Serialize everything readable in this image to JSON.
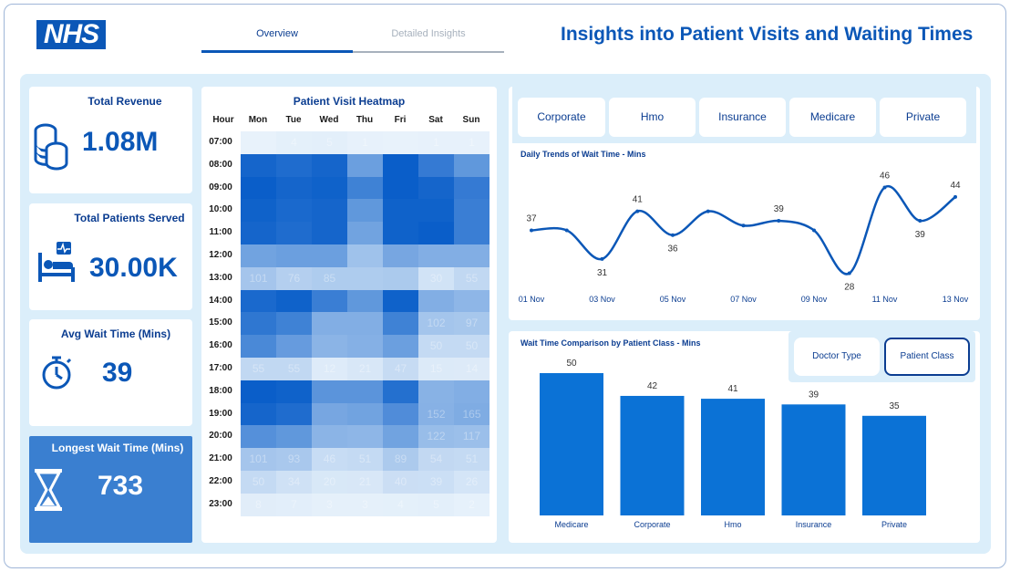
{
  "header": {
    "logo_text": "NHS",
    "tabs": [
      {
        "label": "Overview",
        "active": true
      },
      {
        "label": "Detailed Insights",
        "active": false
      }
    ],
    "title": "Insights into Patient Visits and Waiting Times"
  },
  "kpis": [
    {
      "title": "Total Revenue",
      "value": "1.08M",
      "icon": "coins-icon"
    },
    {
      "title": "Total Patients Served",
      "value": "30.00K",
      "icon": "hospital-bed-icon"
    },
    {
      "title": "Avg Wait Time (Mins)",
      "value": "39",
      "icon": "stopwatch-icon"
    },
    {
      "title": "Longest Wait Time (Mins)",
      "value": "733",
      "icon": "hourglass-icon"
    }
  ],
  "heatmap": {
    "title": "Patient Visit Heatmap",
    "hour_header": "Hour",
    "days": [
      "Mon",
      "Tue",
      "Wed",
      "Thu",
      "Fri",
      "Sat",
      "Sun"
    ],
    "hours": [
      "07:00",
      "08:00",
      "09:00",
      "10:00",
      "11:00",
      "12:00",
      "13:00",
      "14:00",
      "15:00",
      "16:00",
      "17:00",
      "18:00",
      "19:00",
      "20:00",
      "21:00",
      "22:00",
      "23:00"
    ],
    "values": [
      [
        0,
        4,
        5,
        1,
        0,
        1,
        1
      ],
      [
        360,
        340,
        360,
        200,
        380,
        300,
        220
      ],
      [
        380,
        360,
        370,
        280,
        380,
        360,
        300
      ],
      [
        370,
        350,
        360,
        220,
        370,
        370,
        290
      ],
      [
        360,
        340,
        360,
        190,
        370,
        380,
        290
      ],
      [
        190,
        200,
        200,
        110,
        180,
        160,
        160
      ],
      [
        101,
        76,
        85,
        85,
        90,
        30,
        55
      ],
      [
        350,
        370,
        290,
        220,
        370,
        160,
        140
      ],
      [
        310,
        280,
        160,
        160,
        280,
        102,
        97
      ],
      [
        260,
        210,
        145,
        155,
        200,
        50,
        50
      ],
      [
        55,
        55,
        12,
        21,
        47,
        15,
        14
      ],
      [
        380,
        370,
        230,
        230,
        330,
        150,
        160
      ],
      [
        360,
        340,
        180,
        190,
        250,
        152,
        165
      ],
      [
        240,
        220,
        145,
        140,
        190,
        122,
        117
      ],
      [
        101,
        93,
        46,
        51,
        89,
        54,
        51
      ],
      [
        50,
        34,
        20,
        21,
        40,
        39,
        26
      ],
      [
        8,
        7,
        3,
        3,
        4,
        5,
        2
      ]
    ],
    "labels": [
      [
        "",
        "4",
        "5",
        "1",
        "",
        "1",
        "1"
      ],
      [
        "",
        "",
        "",
        "",
        "",
        "",
        ""
      ],
      [
        "",
        "",
        "",
        "",
        "",
        "",
        ""
      ],
      [
        "",
        "",
        "",
        "",
        "",
        "",
        ""
      ],
      [
        "",
        "",
        "",
        "",
        "",
        "",
        ""
      ],
      [
        "",
        "",
        "",
        "",
        "",
        "",
        ""
      ],
      [
        "101",
        "76",
        "85",
        "",
        "",
        "30",
        "55"
      ],
      [
        "",
        "",
        "",
        "",
        "",
        "",
        ""
      ],
      [
        "",
        "",
        "",
        "",
        "",
        "102",
        "97"
      ],
      [
        "",
        "",
        "",
        "",
        "",
        "50",
        "50"
      ],
      [
        "55",
        "55",
        "12",
        "21",
        "47",
        "15",
        "14"
      ],
      [
        "",
        "",
        "",
        "",
        "",
        "",
        ""
      ],
      [
        "",
        "",
        "",
        "",
        "",
        "152",
        "165"
      ],
      [
        "",
        "",
        "",
        "",
        "",
        "122",
        "117"
      ],
      [
        "101",
        "93",
        "46",
        "51",
        "89",
        "54",
        "51"
      ],
      [
        "50",
        "34",
        "20",
        "21",
        "40",
        "39",
        "26"
      ],
      [
        "8",
        "7",
        "3",
        "3",
        "4",
        "5",
        "2"
      ]
    ]
  },
  "filters": {
    "buttons": [
      "Corporate",
      "Hmo",
      "Insurance",
      "Medicare",
      "Private"
    ]
  },
  "line_chart": {
    "title": "Daily Trends of Wait Time - Mins",
    "x_labels": [
      "01 Nov",
      "03 Nov",
      "05 Nov",
      "07 Nov",
      "09 Nov",
      "11 Nov",
      "13 Nov"
    ],
    "values": [
      37,
      37,
      31,
      41,
      36,
      41,
      38,
      39,
      37,
      28,
      46,
      39,
      44
    ],
    "value_labels": [
      "37",
      "",
      "31",
      "41",
      "36",
      "",
      "",
      "39",
      "",
      "28",
      "46",
      "39",
      "44"
    ],
    "ylim": [
      26,
      48
    ]
  },
  "bar_chart": {
    "title": "Wait Time Comparison by Patient Class - Mins",
    "toggle": [
      {
        "label": "Doctor Type",
        "active": false
      },
      {
        "label": "Patient Class",
        "active": true
      }
    ]
  },
  "chart_data": [
    {
      "type": "line",
      "title": "Daily Trends of Wait Time - Mins",
      "x": [
        "01 Nov",
        "02 Nov",
        "03 Nov",
        "04 Nov",
        "05 Nov",
        "06 Nov",
        "07 Nov",
        "08 Nov",
        "09 Nov",
        "10 Nov",
        "11 Nov",
        "12 Nov",
        "13 Nov"
      ],
      "values": [
        37,
        37,
        31,
        41,
        36,
        41,
        38,
        39,
        37,
        28,
        46,
        39,
        44
      ]
    },
    {
      "type": "bar",
      "title": "Wait Time Comparison by Patient Class - Mins",
      "categories": [
        "Medicare",
        "Corporate",
        "Hmo",
        "Insurance",
        "Private"
      ],
      "values": [
        50,
        42,
        41,
        39,
        35
      ],
      "ylim": [
        0,
        50
      ]
    }
  ],
  "colors": {
    "brand": "#0b57b7",
    "heatmap_low": "#e8f2fb",
    "heatmap_high": "#0a5ec9",
    "bar": "#0b72d6",
    "line": "#0b57b7",
    "canvas": "#dbeefa",
    "highlight_card": "#3a7fd0"
  }
}
